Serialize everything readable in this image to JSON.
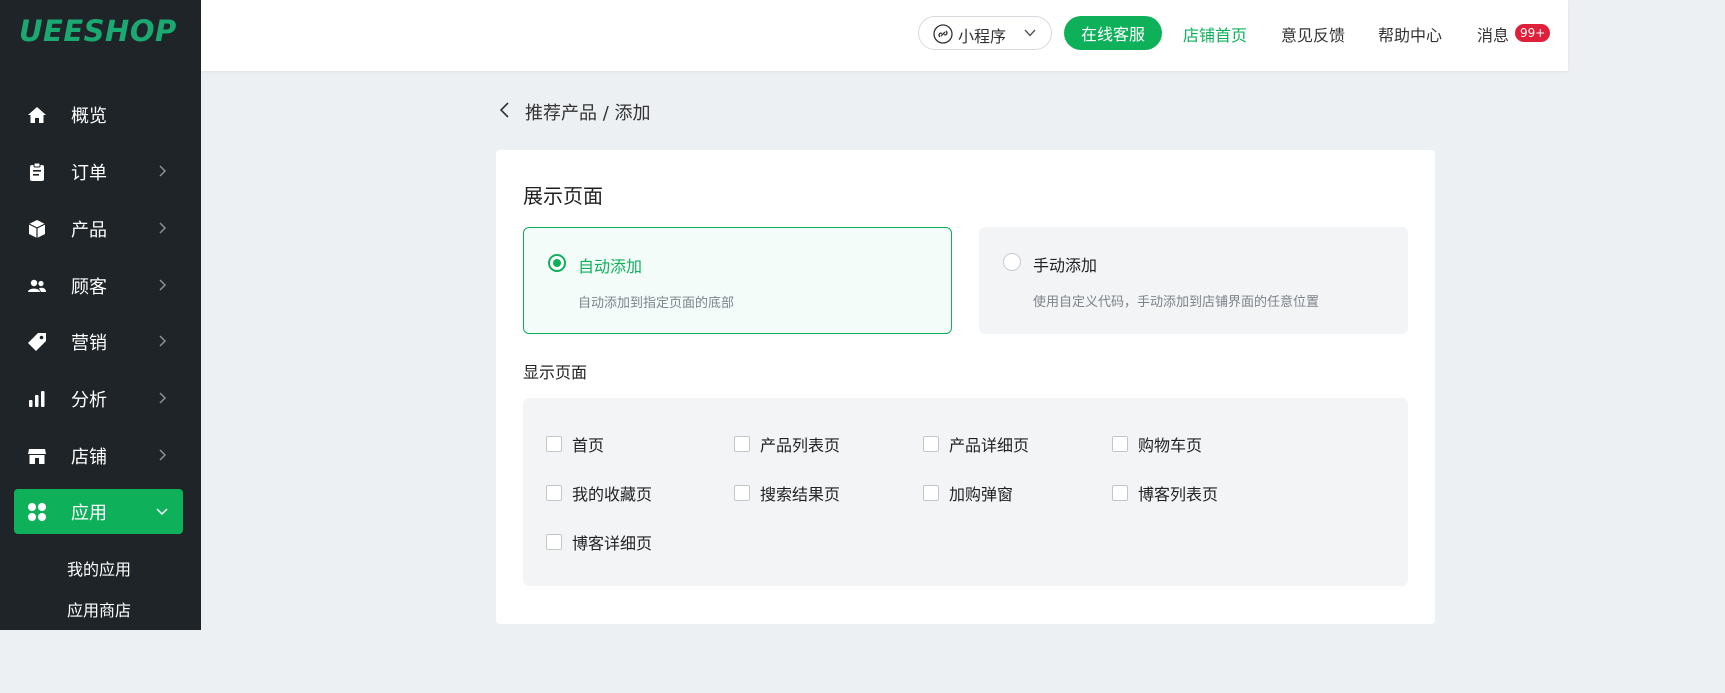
{
  "brand": {
    "logo": "UEESHOP",
    "accent": "#0fb05a"
  },
  "sidebar": {
    "items": [
      {
        "id": "overview",
        "label": "概览",
        "icon": "home-icon",
        "has_children": false
      },
      {
        "id": "orders",
        "label": "订单",
        "icon": "clipboard-icon",
        "has_children": true
      },
      {
        "id": "products",
        "label": "产品",
        "icon": "box-icon",
        "has_children": true
      },
      {
        "id": "customers",
        "label": "顾客",
        "icon": "users-icon",
        "has_children": true
      },
      {
        "id": "marketing",
        "label": "营销",
        "icon": "tag-icon",
        "has_children": true
      },
      {
        "id": "analytics",
        "label": "分析",
        "icon": "bar-chart-icon",
        "has_children": true
      },
      {
        "id": "store",
        "label": "店铺",
        "icon": "storefront-icon",
        "has_children": true
      },
      {
        "id": "apps",
        "label": "应用",
        "icon": "grid-apps-icon",
        "has_children": true,
        "active": true
      }
    ],
    "sub_items": [
      "我的应用",
      "应用商店"
    ]
  },
  "header": {
    "mini_program_label": "小程序",
    "online_service_label": "在线客服",
    "store_home_label": "店铺首页",
    "feedback_label": "意见反馈",
    "help_label": "帮助中心",
    "messages_label": "消息",
    "messages_badge": "99+"
  },
  "breadcrumb": {
    "text": "推荐产品 / 添加"
  },
  "display": {
    "title": "展示页面",
    "options": [
      {
        "label": "自动添加",
        "desc": "自动添加到指定页面的底部",
        "selected": true
      },
      {
        "label": "手动添加",
        "desc": "使用自定义代码，手动添加到店铺界面的任意位置",
        "selected": false
      }
    ],
    "pages_label": "显示页面",
    "pages": [
      {
        "label": "首页",
        "checked": false
      },
      {
        "label": "产品列表页",
        "checked": false
      },
      {
        "label": "产品详细页",
        "checked": false
      },
      {
        "label": "购物车页",
        "checked": false
      },
      {
        "label": "我的收藏页",
        "checked": false
      },
      {
        "label": "搜索结果页",
        "checked": false
      },
      {
        "label": "加购弹窗",
        "checked": false
      },
      {
        "label": "博客列表页",
        "checked": false
      },
      {
        "label": "博客详细页",
        "checked": false
      }
    ]
  }
}
